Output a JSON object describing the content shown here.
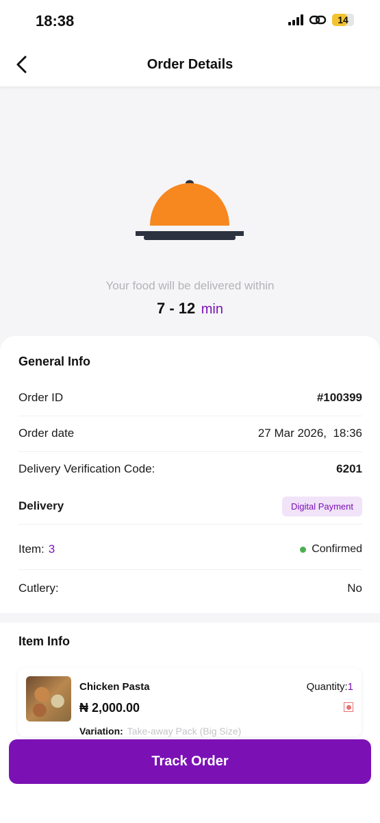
{
  "status_bar": {
    "time": "18:38",
    "battery": "14"
  },
  "header": {
    "title": "Order Details"
  },
  "hero": {
    "message": "Your food will be delivered within",
    "eta_value": "7 - 12",
    "eta_unit": "min"
  },
  "general": {
    "title": "General Info",
    "order_id_label": "Order ID",
    "order_id_value": "#100399",
    "order_date_label": "Order date",
    "order_date_value": "27 Mar 2026,  18:36",
    "verification_label": "Delivery Verification Code:",
    "verification_value": "6201",
    "delivery_label": "Delivery",
    "payment_badge": "Digital Payment",
    "item_label": "Item:",
    "item_count": "3",
    "status": "Confirmed",
    "cutlery_label": "Cutlery:",
    "cutlery_value": "No"
  },
  "item_info": {
    "title": "Item Info",
    "items": [
      {
        "name": "Chicken Pasta",
        "price": "₦ 2,000.00",
        "quantity_label": "Quantity:",
        "quantity": "1",
        "variation_label": "Variation:",
        "variation_value": "Take-away Pack (Big Size)"
      }
    ]
  },
  "actions": {
    "track_label": "Track Order"
  },
  "colors": {
    "accent": "#7b11b5",
    "status_green": "#4caf50",
    "cloche_orange": "#f7871f"
  }
}
